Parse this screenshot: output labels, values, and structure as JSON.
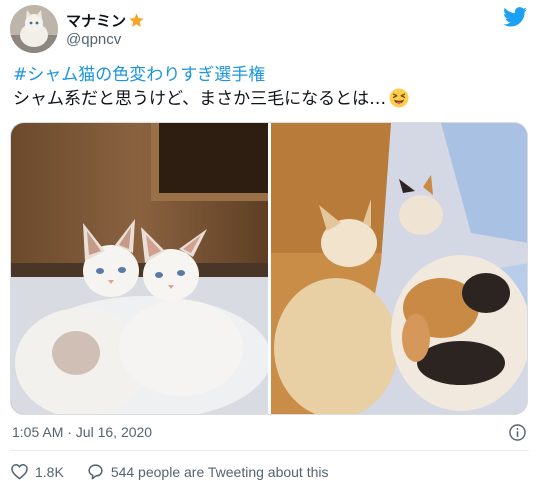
{
  "user": {
    "display_name": "マナミン",
    "handle": "@qpncv",
    "avatar_icon": "cat-avatar-icon",
    "badge_icon": "star-icon"
  },
  "tweet": {
    "hashtag": "#シャム猫の色変わりすぎ選手権",
    "text": "シャム系だと思うけど、まさか三毛になるとは…",
    "emoji": "squinting-tongue-emoji",
    "timestamp": "1:05 AM · Jul 16, 2020"
  },
  "media": {
    "photos": [
      {
        "subject": "two white cats with blue eyes cuddling"
      },
      {
        "subject": "cream cat and calico cat seen from behind"
      }
    ]
  },
  "actions": {
    "like_count": "1.8K",
    "tweeting_text": "544 people are Tweeting about this"
  },
  "colors": {
    "accent": "#1b95e0",
    "secondary_text": "#536471",
    "star": "#f4a623",
    "emoji": "#ffcc4d"
  }
}
